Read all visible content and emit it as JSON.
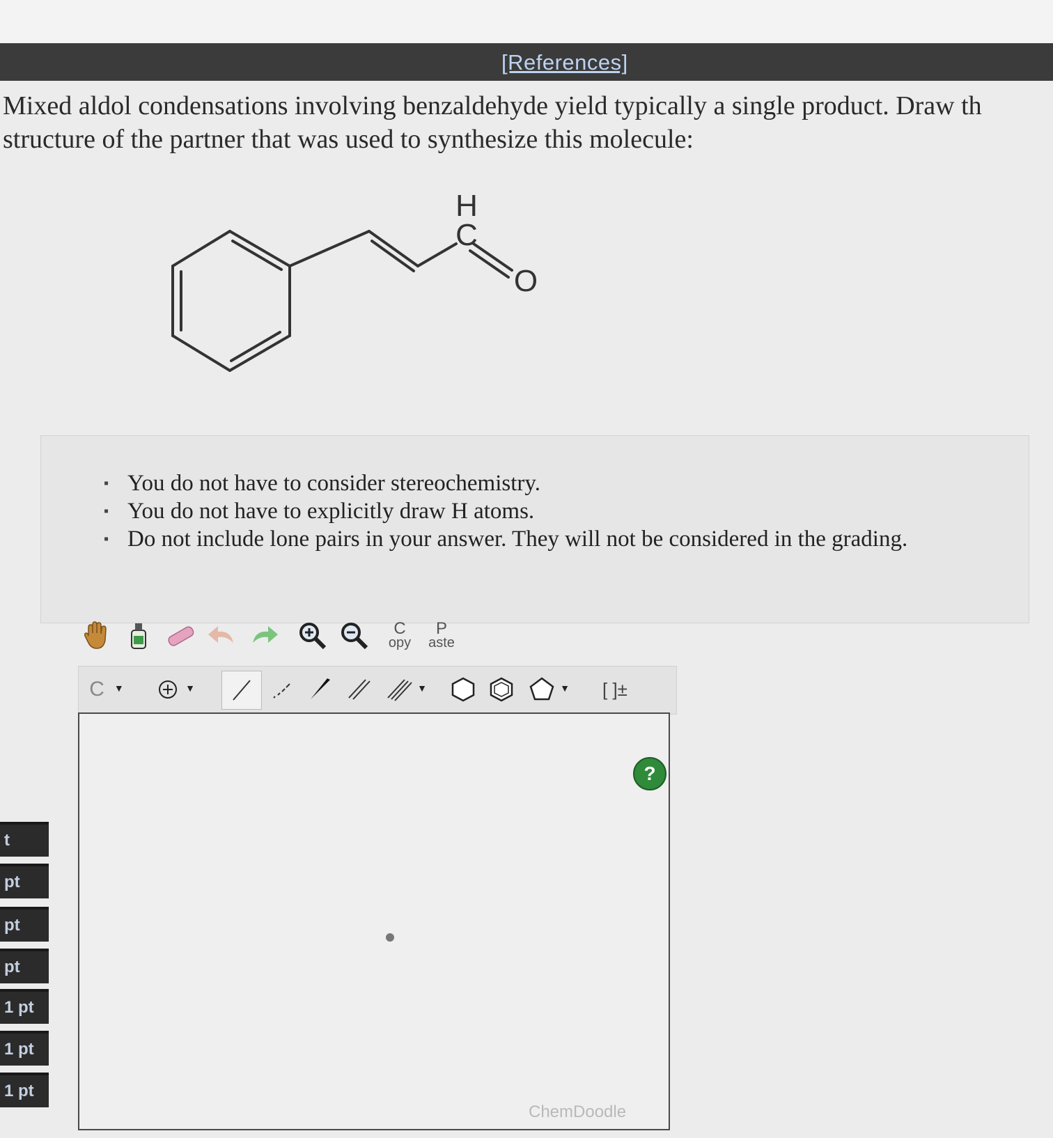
{
  "references_link": "[References]",
  "question": {
    "line1": "Mixed aldol condensations involving benzaldehyde yield typically a single product. Draw th",
    "line2": "structure of the partner that was used to synthesize this molecule:"
  },
  "molecule_labels": {
    "H": "H",
    "C": "C",
    "O": "O"
  },
  "instructions": [
    "You do not have to consider stereochemistry.",
    "You do not have to explicitly draw H atoms.",
    "Do not include lone pairs in your answer. They will not be considered in the grading."
  ],
  "toolbar": {
    "copy_big": "C",
    "copy_small": "opy",
    "paste_big": "P",
    "paste_small": "aste",
    "element": "C",
    "charge_label": "[ ]±"
  },
  "help_label": "?",
  "watermark": "ChemDoodle",
  "side_nav": [
    "t",
    "pt",
    "pt",
    "pt",
    "1 pt",
    "1 pt",
    "1 pt"
  ],
  "colors": {
    "help_green": "#2f8a3a",
    "references": "#bcd3f0"
  }
}
